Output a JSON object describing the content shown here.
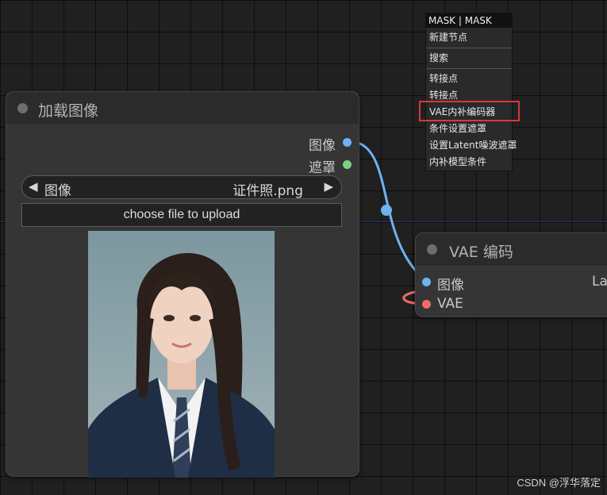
{
  "load_node": {
    "title": "加载图像",
    "outputs": [
      "图像",
      "遮罩"
    ],
    "widget_label": "图像",
    "widget_value": "证件照.png",
    "upload_label": "choose file to upload"
  },
  "vae_node": {
    "title": "VAE 编码",
    "inputs": [
      "图像",
      "VAE"
    ],
    "output_partial": "La"
  },
  "context_menu": {
    "title": "MASK | MASK",
    "items": [
      "新建节点",
      "搜索",
      "转接点",
      "转接点",
      "VAE内补编码器",
      "条件设置遮罩",
      "设置Latent噪波遮罩",
      "内补模型条件"
    ],
    "highlighted": "VAE内补编码器"
  },
  "colors": {
    "image_slot": "#6cb3f2",
    "mask_slot": "#7fcf7f",
    "vae_slot": "#f06a6a",
    "highlight": "#d9363e"
  },
  "watermark": "CSDN @浮华落定"
}
